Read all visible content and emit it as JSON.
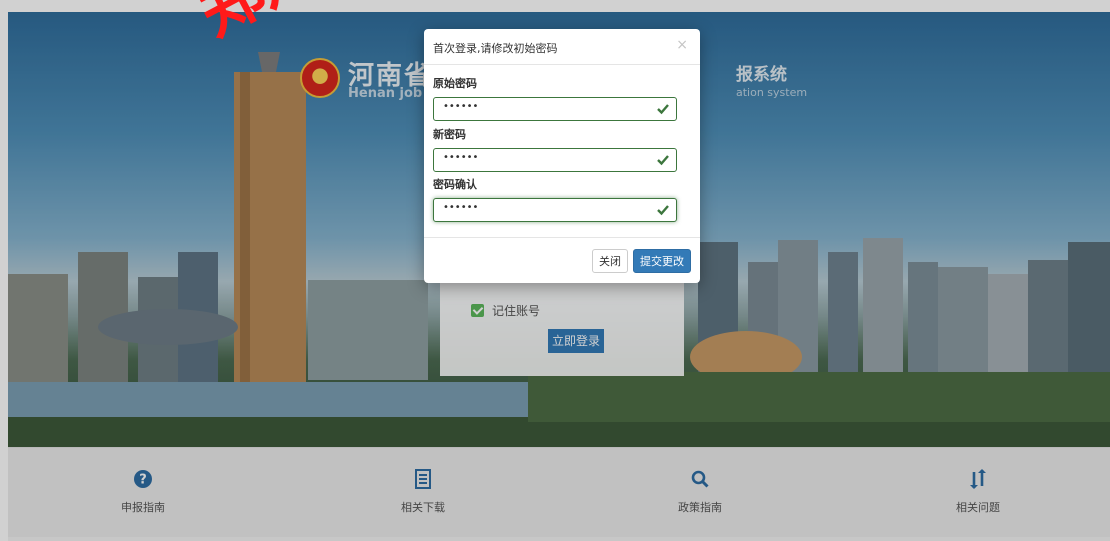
{
  "header": {
    "title_cn_left": "河南省",
    "title_en_left": "Henan job",
    "title_cn_right": "报系统",
    "title_en_right": "ation system"
  },
  "stamp_text": "郑州",
  "modal": {
    "title": "首次登录,请修改初始密码",
    "close_symbol": "×",
    "fields": [
      {
        "label": "原始密码",
        "value": "••••••",
        "status": "valid"
      },
      {
        "label": "新密码",
        "value": "••••••",
        "status": "valid"
      },
      {
        "label": "密码确认",
        "value": "••••••",
        "status": "valid"
      }
    ],
    "close_button": "关闭",
    "submit_button": "提交更改"
  },
  "login": {
    "remember_label": "记住账号",
    "login_button": "立即登录"
  },
  "bottom_nav": [
    {
      "label": "申报指南",
      "icon": "question-circle-icon"
    },
    {
      "label": "相关下载",
      "icon": "list-doc-icon"
    },
    {
      "label": "政策指南",
      "icon": "search-icon"
    },
    {
      "label": "相关问题",
      "icon": "sort-arrows-icon"
    }
  ],
  "colors": {
    "accent_blue": "#337ab7",
    "valid_green": "#3c763d",
    "stamp_red": "#ff1a1a",
    "nav_bg": "#ececec"
  }
}
